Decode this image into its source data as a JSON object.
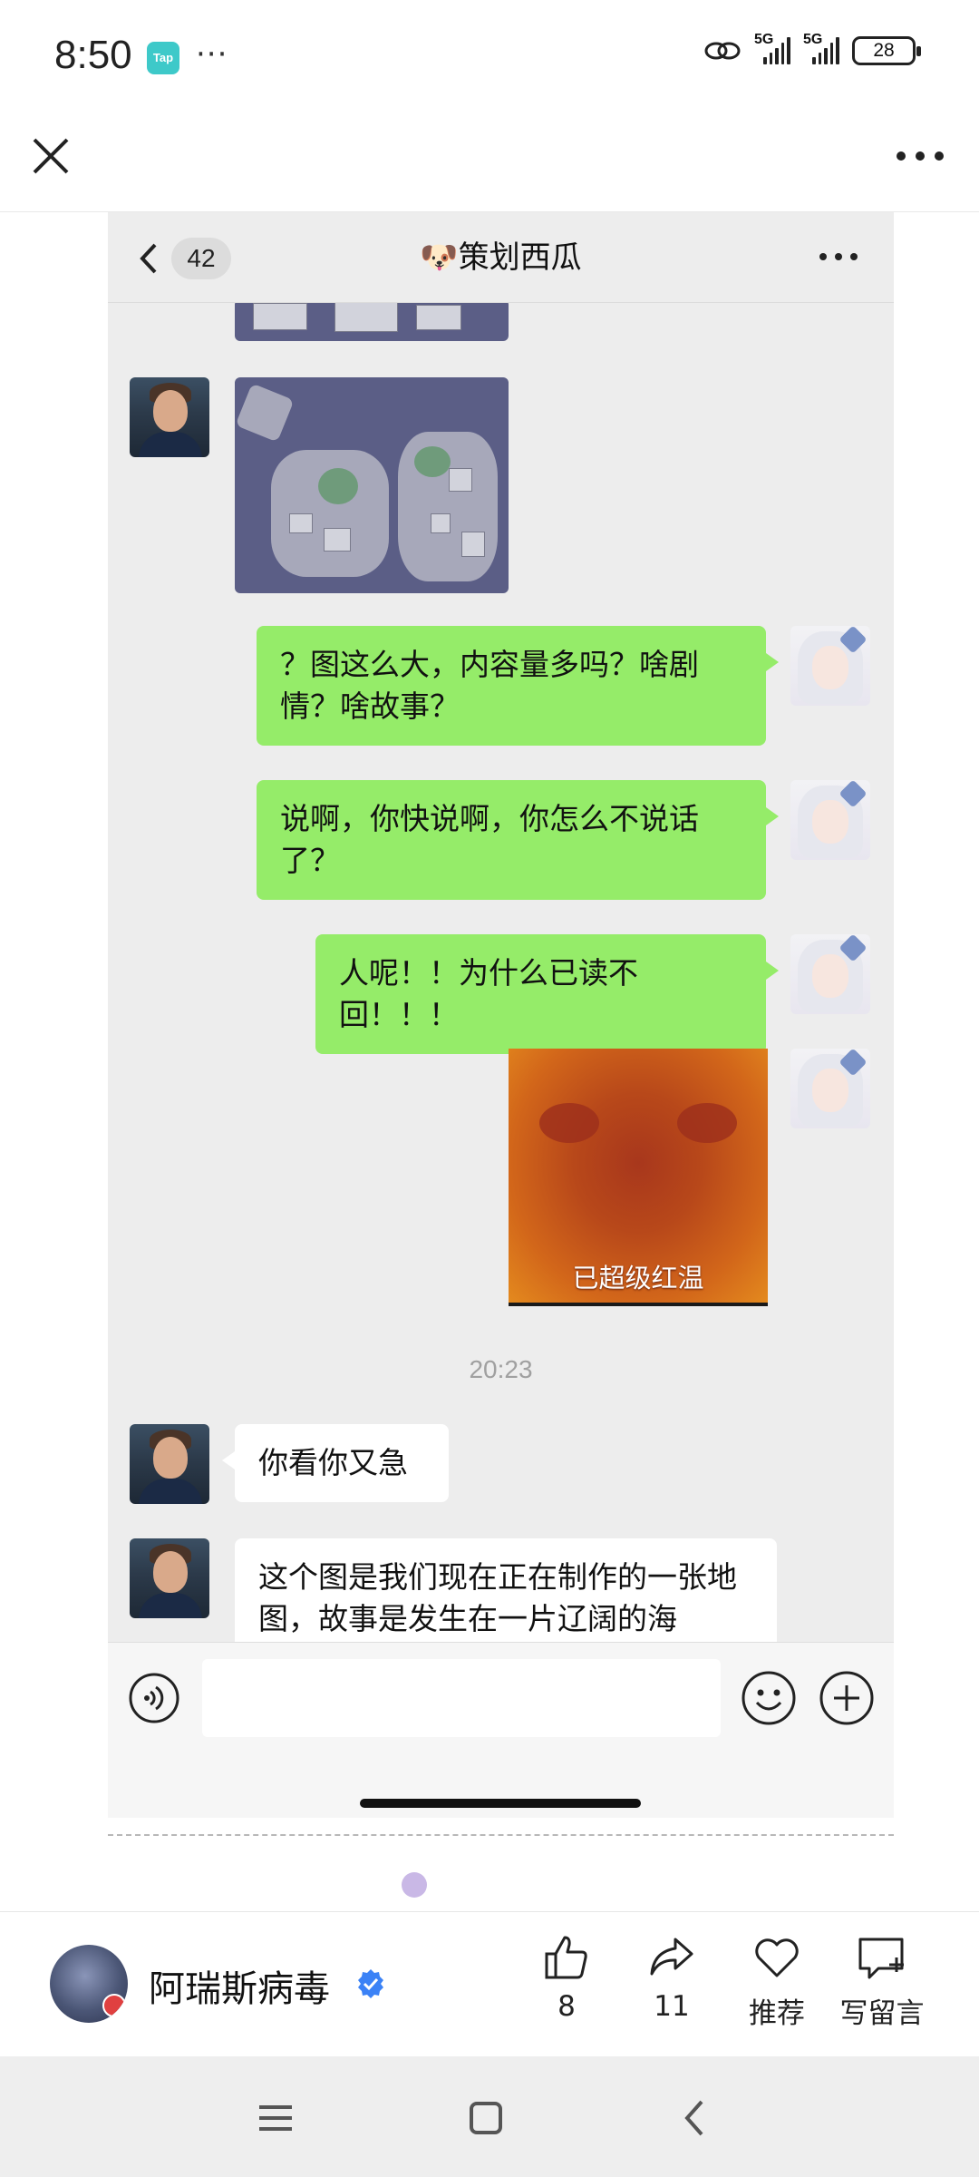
{
  "status_bar": {
    "time": "8:50",
    "app_badge": "Tap",
    "dots": "···",
    "signal_1_label": "5G",
    "signal_2_label": "5G",
    "battery": "28"
  },
  "chat": {
    "unread_count": "42",
    "title": "🐶策划西瓜",
    "messages": {
      "m1": "？图这么大，内容量多吗？啥剧情？啥故事？",
      "m2": "说啊，你快说啊，你怎么不说话了？",
      "m3": "人呢！！为什么已读不回！！！",
      "sticker_caption": "已超级红温",
      "timestamp": "20:23",
      "m4": "你看你又急",
      "m5": "这个图是我们现在正在制作的一张地图，故事是发生在一片辽阔的海"
    }
  },
  "author": {
    "name": "阿瑞斯病毒"
  },
  "actions": {
    "like_count": "8",
    "share_count": "11",
    "recommend_label": "推荐",
    "comment_label": "写留言"
  },
  "colors": {
    "bubble_green": "#95ec69",
    "chat_bg": "#ededed",
    "verified_blue": "#3b82f6"
  }
}
